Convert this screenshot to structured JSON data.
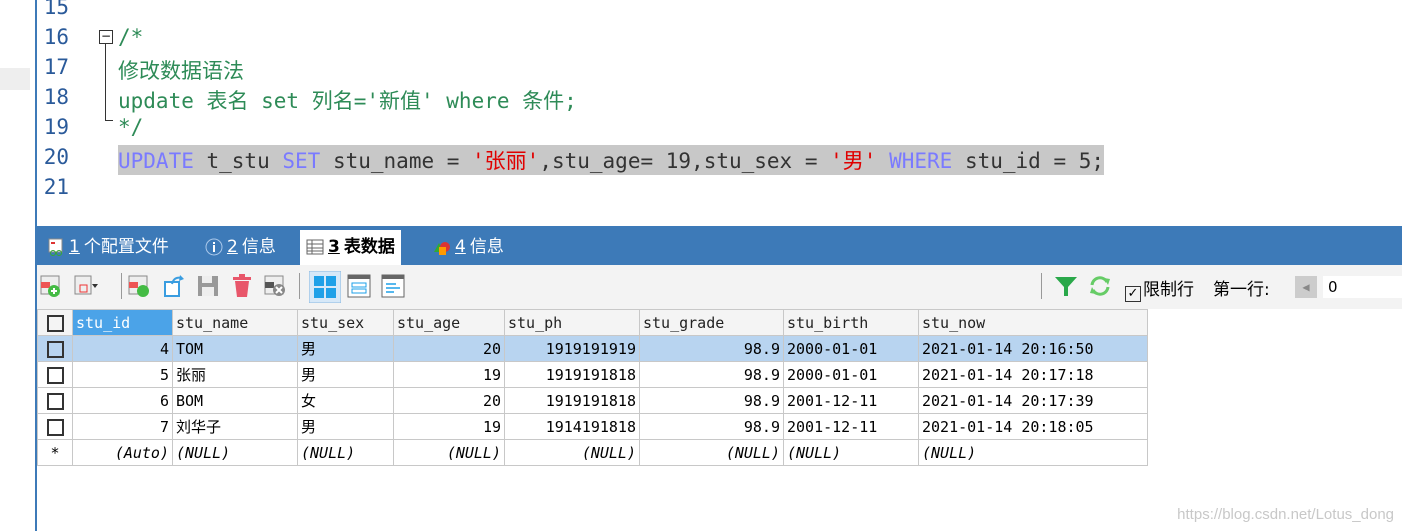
{
  "editor": {
    "lines": [
      {
        "n": "15"
      },
      {
        "n": "16",
        "t": "/*"
      },
      {
        "n": "17",
        "t": "修改数据语法"
      },
      {
        "n": "18",
        "t": "update 表名 set 列名='新值' where 条件;"
      },
      {
        "n": "19",
        "t": "*/"
      },
      {
        "n": "20",
        "parts": [
          "UPDATE",
          " t_stu ",
          "SET",
          " stu_name = ",
          "'张丽'",
          ",stu_age= 19,stu_sex = ",
          "'男'",
          " ",
          "WHERE",
          " stu_id = 5;"
        ]
      },
      {
        "n": "21"
      }
    ]
  },
  "tabs": [
    {
      "num": "1",
      "label": "个配置文件"
    },
    {
      "num": "2",
      "label": "信息"
    },
    {
      "num": "3",
      "label": "表数据"
    },
    {
      "num": "4",
      "label": "信息"
    }
  ],
  "toolbar": {
    "limit_label": "限制行",
    "first_row_label": "第一行:",
    "first_row_value": "0",
    "limit_checked": true
  },
  "grid": {
    "columns": [
      "stu_id",
      "stu_name",
      "stu_sex",
      "stu_age",
      "stu_ph",
      "stu_grade",
      "stu_birth",
      "stu_now"
    ],
    "rows": [
      [
        "4",
        "TOM",
        "男",
        "20",
        "1919191919",
        "98.9",
        "2000-01-01",
        "2021-01-14 20:16:50"
      ],
      [
        "5",
        "张丽",
        "男",
        "19",
        "1919191818",
        "98.9",
        "2000-01-01",
        "2021-01-14 20:17:18"
      ],
      [
        "6",
        "BOM",
        "女",
        "20",
        "1919191818",
        "98.9",
        "2001-12-11",
        "2021-01-14 20:17:39"
      ],
      [
        "7",
        "刘华子",
        "男",
        "19",
        "1914191818",
        "98.9",
        "2001-12-11",
        "2021-01-14 20:18:05"
      ]
    ],
    "new_row": {
      "marker": "*",
      "values": [
        "(Auto)",
        "(NULL)",
        "(NULL)",
        "(NULL)",
        "(NULL)",
        "(NULL)",
        "(NULL)",
        "(NULL)"
      ]
    }
  },
  "watermark": "https://blog.csdn.net/Lotus_dong"
}
